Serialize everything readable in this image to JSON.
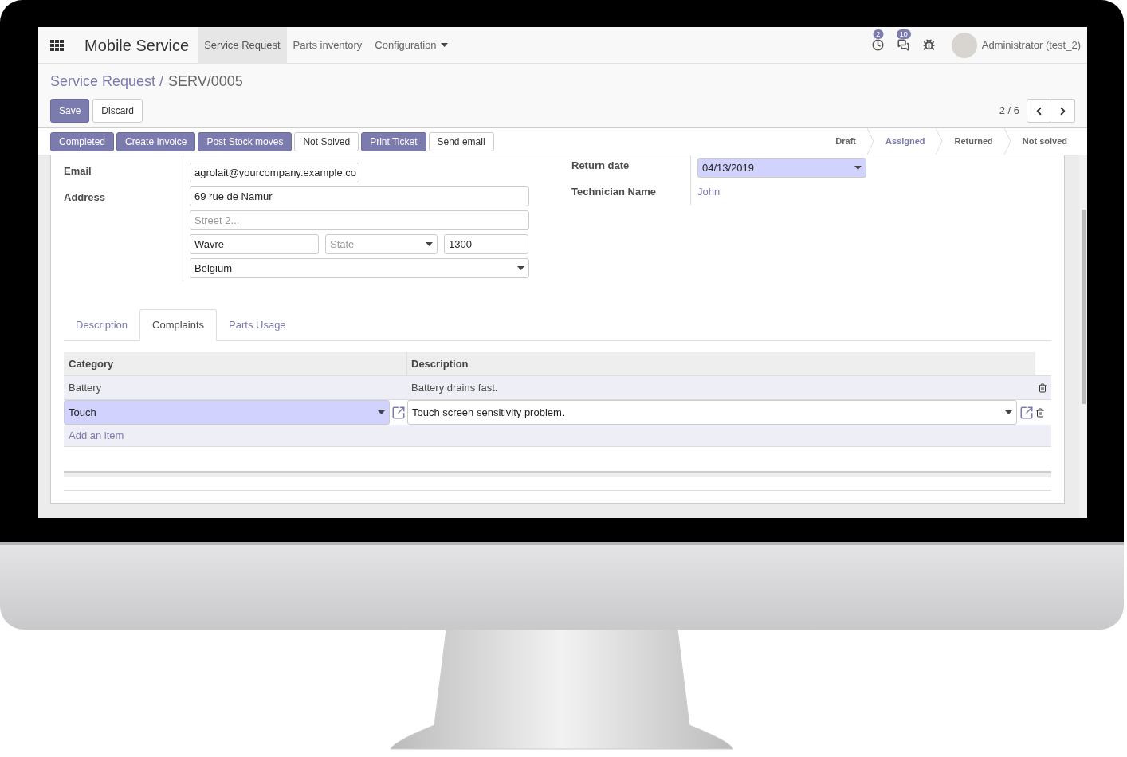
{
  "app_title": "Mobile Service",
  "menus": [
    {
      "label": "Service Request",
      "selected": true,
      "dropdown": false
    },
    {
      "label": "Parts inventory",
      "selected": false,
      "dropdown": false
    },
    {
      "label": "Configuration",
      "selected": false,
      "dropdown": true
    }
  ],
  "systray": [
    {
      "kind": "activity",
      "badge": "2"
    },
    {
      "kind": "messages",
      "badge": "10"
    },
    {
      "kind": "debug"
    }
  ],
  "user": {
    "name": "Administrator (test_2)"
  },
  "breadcrumb": {
    "parent": "Service Request /",
    "current": "SERV/0005"
  },
  "form_buttons": [
    {
      "label": "Save",
      "kind": "primary"
    },
    {
      "label": "Discard",
      "kind": "secondary"
    }
  ],
  "pager": "2 / 6",
  "actions": [
    {
      "label": "Completed",
      "kind": "primary"
    },
    {
      "label": "Create Invoice",
      "kind": "primary"
    },
    {
      "label": "Post Stock moves",
      "kind": "primary"
    },
    {
      "label": "Not Solved",
      "kind": "secondary"
    },
    {
      "label": "Print Ticket",
      "kind": "primary"
    },
    {
      "label": "Send email",
      "kind": "secondary"
    }
  ],
  "stages": [
    {
      "label": "Draft",
      "selected": false
    },
    {
      "label": "Assigned",
      "selected": true
    },
    {
      "label": "Returned",
      "selected": false
    },
    {
      "label": "Not solved",
      "selected": false
    }
  ],
  "left_fields": {
    "email": {
      "label": "Email",
      "value": "agrolait@yourcompany.example.co"
    },
    "address": {
      "label": "Address",
      "street": "69 rue de Namur",
      "street2_placeholder": "Street 2...",
      "city": "Wavre",
      "state_placeholder": "State",
      "zip": "1300",
      "country": "Belgium"
    }
  },
  "right_fields": {
    "return_date": {
      "label": "Return date",
      "value": "04/13/2019"
    },
    "technician": {
      "label": "Technician Name",
      "value": "John"
    }
  },
  "tabs": [
    {
      "label": "Description",
      "selected": false
    },
    {
      "label": "Complaints",
      "selected": true
    },
    {
      "label": "Parts Usage",
      "selected": false
    }
  ],
  "table": {
    "columns": [
      "Category",
      "Description"
    ],
    "rows": [
      {
        "kind": "view",
        "category": "Battery",
        "description": "Battery drains fast."
      },
      {
        "kind": "edit",
        "category": "Touch",
        "description": "Touch screen sensitivity problem."
      }
    ],
    "add_item": "Add an item"
  }
}
